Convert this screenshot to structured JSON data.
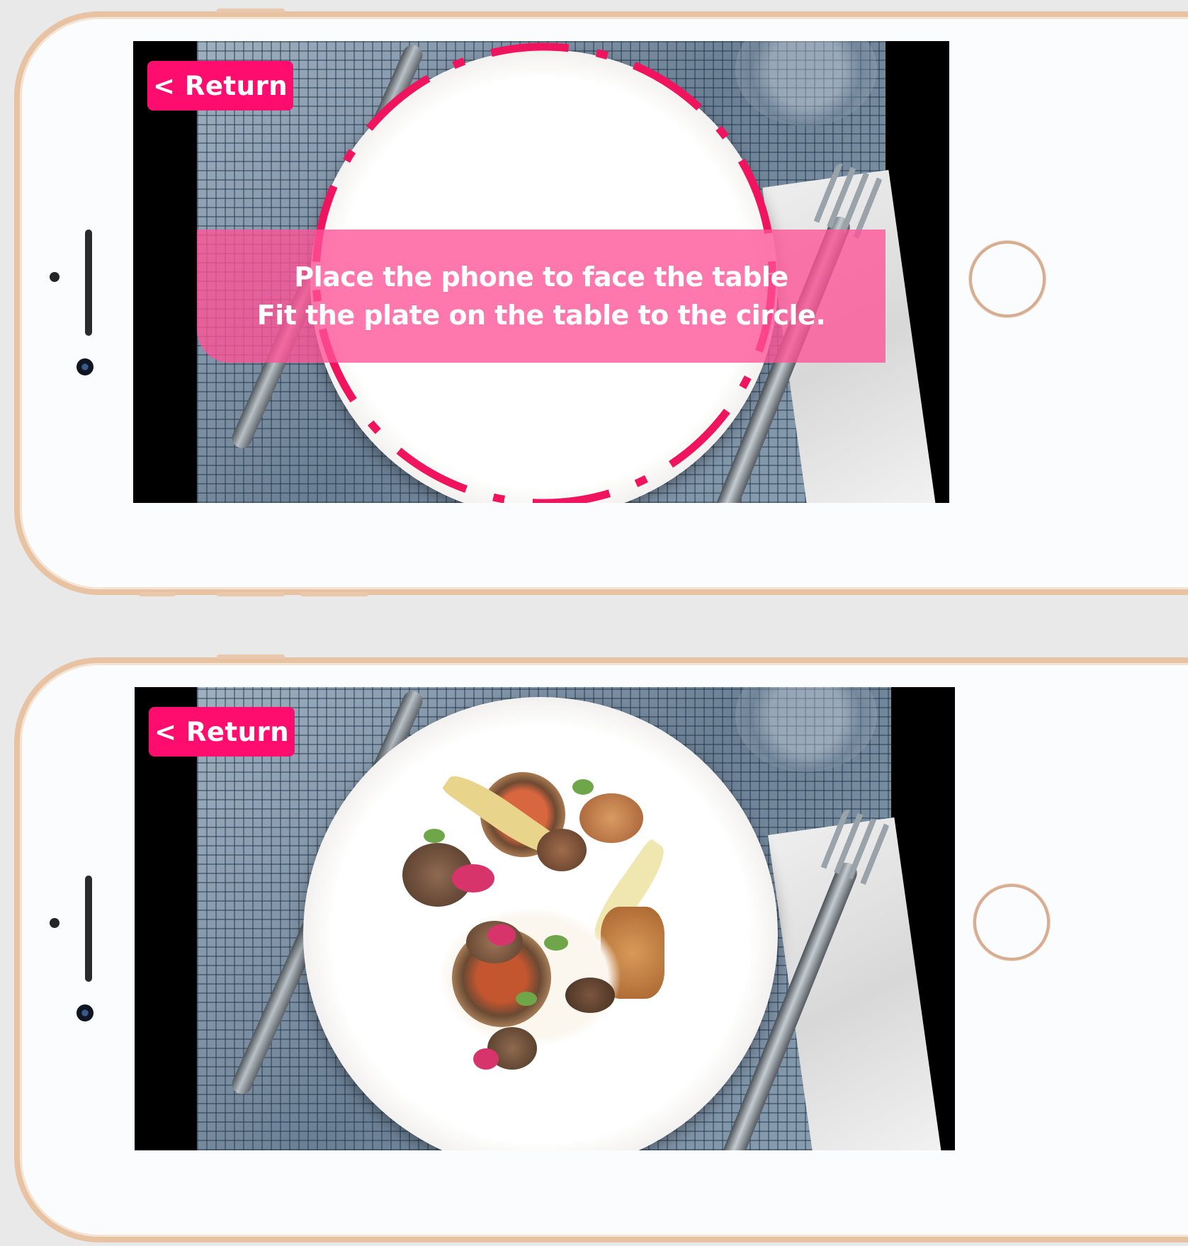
{
  "screens": [
    {
      "return_label": "< Return",
      "instruction_line1": "Place the phone to face the table",
      "instruction_line2": "Fit the plate on the table to the circle."
    },
    {
      "return_label": "< Return"
    }
  ],
  "colors": {
    "accent": "#ff0d6e",
    "banner": "#ff5296",
    "guide": "#f0145f",
    "frame": "#e8c3a3"
  },
  "icons": [
    "speaker-grille",
    "proximity-sensor",
    "front-camera",
    "home-button"
  ]
}
